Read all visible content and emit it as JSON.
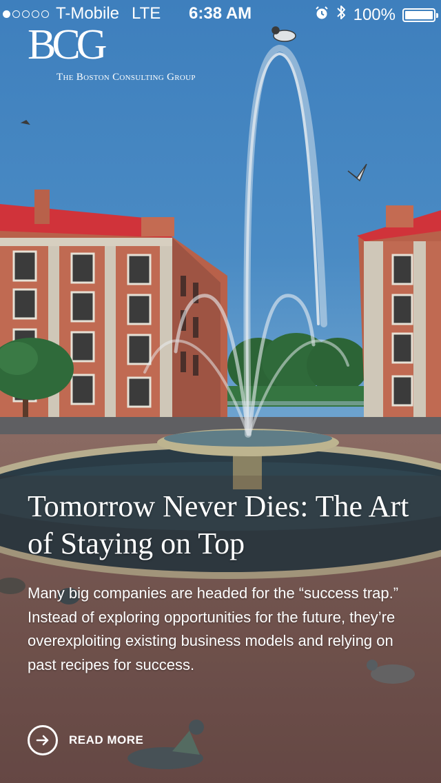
{
  "status_bar": {
    "carrier": "T-Mobile",
    "network": "LTE",
    "time": "6:38 AM",
    "battery": "100%",
    "signal_bars": 1,
    "signal_max": 5
  },
  "brand": {
    "logo_mark": "BCG",
    "logo_subtitle": "The Boston Consulting Group"
  },
  "article": {
    "headline": "Tomorrow Never Dies: The Art of Staying on Top",
    "summary": "Many big companies are headed for the “success trap.” Instead of exploring opportunities for the future, they’re overexploiting existing business models and relying on past recipes for success.",
    "cta_label": "READ MORE"
  },
  "icons": {
    "alarm": "alarm-icon",
    "bluetooth": "bluetooth-icon",
    "battery": "battery-icon",
    "cta": "arrow-right-circle-icon"
  },
  "colors": {
    "sky": "#3f82bf",
    "roof": "#d0333a",
    "building": "#b8614a",
    "plaza": "#7c5a54",
    "water": "#2a3b45",
    "tree": "#2f6a3a",
    "text": "#ffffff"
  }
}
